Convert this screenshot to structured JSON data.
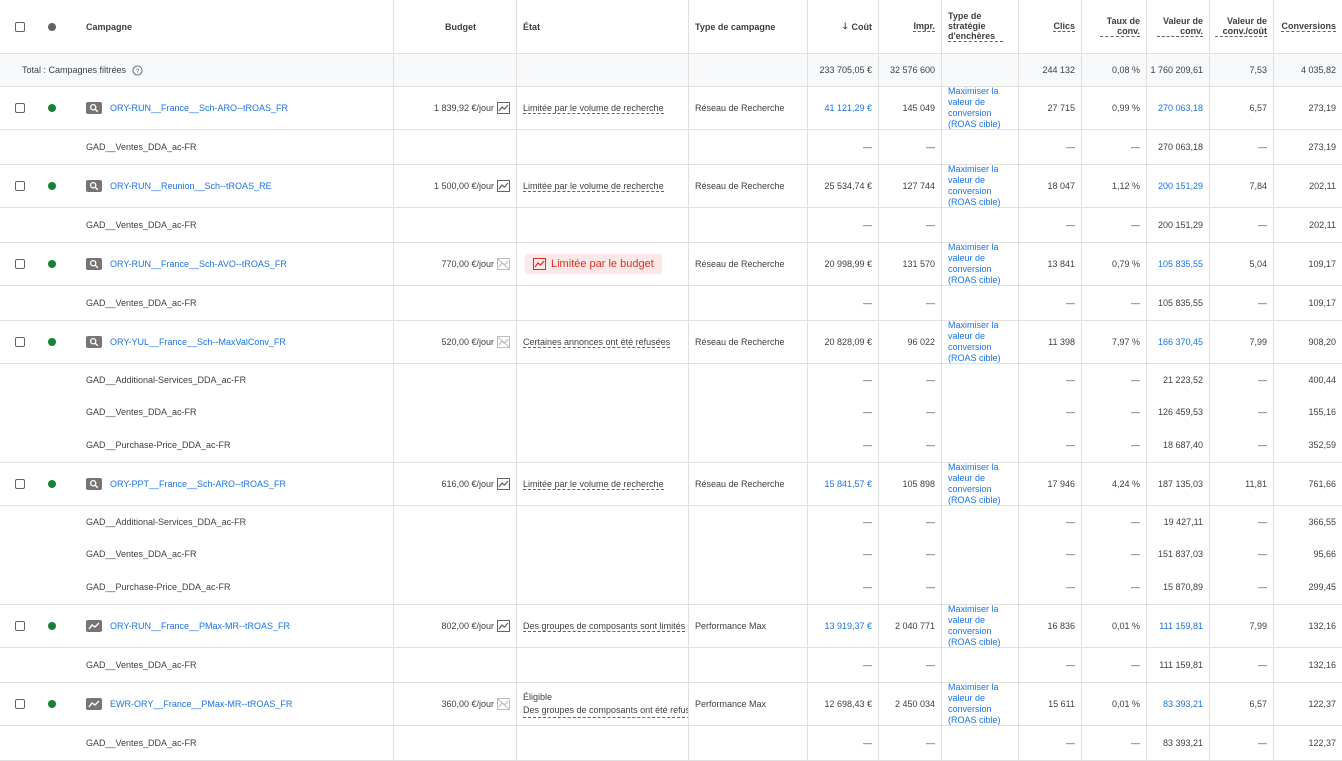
{
  "headers": {
    "campaign": "Campagne",
    "budget": "Budget",
    "state": "État",
    "campaign_type": "Type de campagne",
    "cost": "Coût",
    "impr": "Impr.",
    "strategy": "Type de stratégie d'enchères",
    "clicks": "Clics",
    "conv_rate": "Taux de conv.",
    "conv_value": "Valeur de conv.",
    "value_cost": "Valeur de conv./coût",
    "conversions": "Conversions"
  },
  "total": {
    "label": "Total : Campagnes filtrées",
    "cost": "233 705,05 €",
    "impr": "32 576 600",
    "clicks": "244 132",
    "conv_rate": "0,08 %",
    "conv_value": "1 760 209,61",
    "value_cost": "7,53",
    "conversions": "4 035,82"
  },
  "dash": "—",
  "rows": [
    {
      "kind": "camp",
      "name": "ORY-RUN__France__Sch-ARO--tROAS_FR",
      "icon": "search",
      "budget": "1 839,92 €/jour",
      "trend": "up",
      "state": "Limitée par le volume de recherche",
      "type": "Réseau de Recherche",
      "cost": "41 121,29 €",
      "cost_link": true,
      "impr": "145 049",
      "strategy": "Maximiser la valeur de conversion (ROAS cible)",
      "clicks": "27 715",
      "conv_rate": "0,99 %",
      "conv_value": "270 063,18",
      "value_link": true,
      "value_cost": "6,57",
      "conversions": "273,19"
    },
    {
      "kind": "sub",
      "name": "GAD__Ventes_DDA_ac-FR",
      "conv_value": "270 063,18",
      "conversions": "273,19"
    },
    {
      "kind": "camp",
      "name": "ORY-RUN__Reunion__Sch--tROAS_RE",
      "icon": "search",
      "budget": "1 500,00 €/jour",
      "trend": "up",
      "state": "Limitée par le volume de recherche",
      "type": "Réseau de Recherche",
      "cost": "25 534,74 €",
      "cost_link": false,
      "impr": "127 744",
      "strategy": "Maximiser la valeur de conversion (ROAS cible)",
      "clicks": "18 047",
      "conv_rate": "1,12 %",
      "conv_value": "200 151,29",
      "value_link": true,
      "value_cost": "7,84",
      "conversions": "202,11"
    },
    {
      "kind": "sub",
      "name": "GAD__Ventes_DDA_ac-FR",
      "conv_value": "200 151,29",
      "conversions": "202,11"
    },
    {
      "kind": "camp",
      "name": "ORY-RUN__France__Sch-AVO--tROAS_FR",
      "icon": "search",
      "budget": "770,00 €/jour",
      "trend": "off",
      "state": "Limitée par le budget",
      "badge": true,
      "type": "Réseau de Recherche",
      "cost": "20 998,99 €",
      "cost_link": false,
      "impr": "131 570",
      "strategy": "Maximiser la valeur de conversion (ROAS cible)",
      "clicks": "13 841",
      "conv_rate": "0,79 %",
      "conv_value": "105 835,55",
      "value_link": true,
      "value_cost": "5,04",
      "conversions": "109,17"
    },
    {
      "kind": "sub",
      "name": "GAD__Ventes_DDA_ac-FR",
      "conv_value": "105 835,55",
      "conversions": "109,17"
    },
    {
      "kind": "camp",
      "name": "ORY-YUL__France__Sch--MaxValConv_FR",
      "icon": "search",
      "budget": "520,00 €/jour",
      "trend": "off",
      "state": "Certaines annonces ont été refusées",
      "type": "Réseau de Recherche",
      "cost": "20 828,09 €",
      "cost_link": false,
      "impr": "96 022",
      "strategy": "Maximiser la valeur de conversion (ROAS cible)",
      "clicks": "11 398",
      "conv_rate": "7,97 %",
      "conv_value": "166 370,45",
      "value_link": true,
      "value_cost": "7,99",
      "conversions": "908,20"
    },
    {
      "kind": "sub",
      "name": "GAD__Additional-Services_DDA_ac-FR",
      "conv_value": "21 223,52",
      "conversions": "400,44",
      "nogap": true
    },
    {
      "kind": "sub",
      "name": "GAD__Ventes_DDA_ac-FR",
      "conv_value": "126 459,53",
      "conversions": "155,16",
      "nogap": true
    },
    {
      "kind": "sub",
      "name": "GAD__Purchase-Price_DDA_ac-FR",
      "conv_value": "18 687,40",
      "conversions": "352,59"
    },
    {
      "kind": "camp",
      "name": "ORY-PPT__France__Sch-ARO--tROAS_FR",
      "icon": "search",
      "budget": "616,00 €/jour",
      "trend": "up",
      "state": "Limitée par le volume de recherche",
      "type": "Réseau de Recherche",
      "cost": "15 841,57 €",
      "cost_link": true,
      "impr": "105 898",
      "strategy": "Maximiser la valeur de conversion (ROAS cible)",
      "clicks": "17 946",
      "conv_rate": "4,24 %",
      "conv_value": "187 135,03",
      "value_link": false,
      "value_cost": "11,81",
      "conversions": "761,66"
    },
    {
      "kind": "sub",
      "name": "GAD__Additional-Services_DDA_ac-FR",
      "conv_value": "19 427,11",
      "conversions": "366,55",
      "nogap": true
    },
    {
      "kind": "sub",
      "name": "GAD__Ventes_DDA_ac-FR",
      "conv_value": "151 837,03",
      "conversions": "95,66",
      "nogap": true
    },
    {
      "kind": "sub",
      "name": "GAD__Purchase-Price_DDA_ac-FR",
      "conv_value": "15 870,89",
      "conversions": "299,45"
    },
    {
      "kind": "camp",
      "name": "ORY-RUN__France__PMax-MR--tROAS_FR",
      "icon": "pmax",
      "budget": "802,00 €/jour",
      "trend": "up",
      "state": "Des groupes de composants sont limités",
      "type": "Performance Max",
      "cost": "13 919,37 €",
      "cost_link": true,
      "impr": "2 040 771",
      "strategy": "Maximiser la valeur de conversion (ROAS cible)",
      "clicks": "16 836",
      "conv_rate": "0,01 %",
      "conv_value": "111 159,81",
      "value_link": true,
      "value_cost": "7,99",
      "conversions": "132,16"
    },
    {
      "kind": "sub",
      "name": "GAD__Ventes_DDA_ac-FR",
      "conv_value": "111 159,81",
      "conversions": "132,16"
    },
    {
      "kind": "camp",
      "name": "EWR-ORY__France__PMax-MR--tROAS_FR",
      "icon": "pmax",
      "budget": "360,00 €/jour",
      "trend": "off",
      "state": "Éligible",
      "state2": "Des groupes de composants ont été refusés",
      "type": "Performance Max",
      "cost": "12 698,43 €",
      "cost_link": false,
      "impr": "2 450 034",
      "strategy": "Maximiser la valeur de conversion (ROAS cible)",
      "clicks": "15 611",
      "conv_rate": "0,01 %",
      "conv_value": "83 393,21",
      "value_link": true,
      "value_cost": "6,57",
      "conversions": "122,37"
    },
    {
      "kind": "sub",
      "name": "GAD__Ventes_DDA_ac-FR",
      "conv_value": "83 393,21",
      "conversions": "122,37"
    }
  ]
}
